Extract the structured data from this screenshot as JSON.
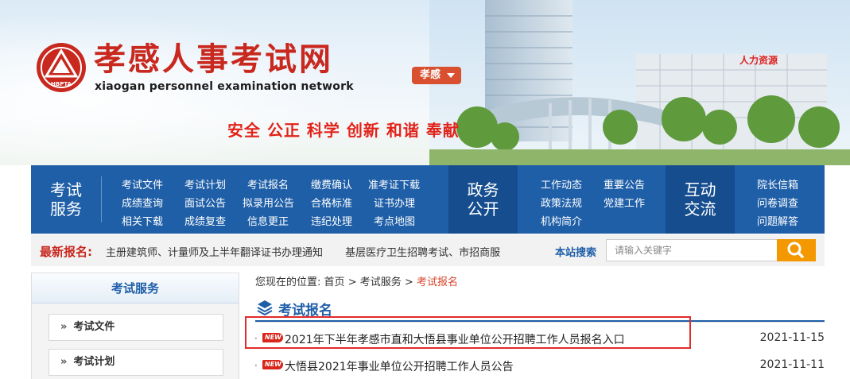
{
  "header": {
    "site_title_cn": "孝感人事考试网",
    "site_title_en": "xiaogan personnel examination network",
    "logo_text": "HBPTA",
    "city_select": "孝感",
    "slogan": "安全 公正 科学 创新 和谐 奉献",
    "building_sign": "人力资源"
  },
  "nav": {
    "sections": [
      {
        "title": "考试服务",
        "links": [
          [
            "考试文件",
            "考试计划",
            "考试报名",
            "缴费确认",
            "准考证下载"
          ],
          [
            "成绩查询",
            "面试公告",
            "拟录用公告",
            "合格标准",
            "证书办理"
          ],
          [
            "相关下载",
            "成绩复查",
            "信息更正",
            "违纪处理",
            "考点地图"
          ]
        ]
      },
      {
        "title": "政务公开",
        "links": [
          [
            "工作动态",
            "重要公告"
          ],
          [
            "政策法规",
            "党建工作"
          ],
          [
            "机构简介"
          ]
        ]
      },
      {
        "title": "互动交流",
        "links": [
          [
            "院长信箱"
          ],
          [
            "问卷调查"
          ],
          [
            "问题解答"
          ]
        ]
      }
    ]
  },
  "newsbar": {
    "label": "最新报名:",
    "items": [
      "主册建筑师、计量师及上半年翻译证书办理通知",
      "基层医疗卫生招聘考试、市招商服"
    ],
    "search_label": "本站搜索",
    "search_placeholder": "请输入关键字",
    "search_value": ""
  },
  "sidebar": {
    "title": "考试服务",
    "items": [
      {
        "arrow": "»",
        "label": "考试文件"
      },
      {
        "arrow": "»",
        "label": "考试计划"
      }
    ]
  },
  "main": {
    "breadcrumb": {
      "prefix": "您现在的位置:",
      "home": "首页",
      "sep1": ">",
      "level2": "考试服务",
      "sep2": ">",
      "current": "考试报名"
    },
    "section_title": "考试报名",
    "articles": [
      {
        "dot": "·",
        "badge": "NEW",
        "title": "2021年下半年孝感市直和大悟县事业单位公开招聘工作人员报名入口",
        "date": "2021-11-15"
      },
      {
        "dot": "·",
        "badge": "NEW",
        "title": "大悟县2021年事业单位公开招聘工作人员公告",
        "date": "2021-11-11"
      }
    ]
  },
  "colors": {
    "brand_red": "#c8281e",
    "nav_blue": "#1f5fa8",
    "nav_blue_dark": "#154d8f",
    "search_orange": "#f39800",
    "highlight_red": "#e22a2a"
  }
}
